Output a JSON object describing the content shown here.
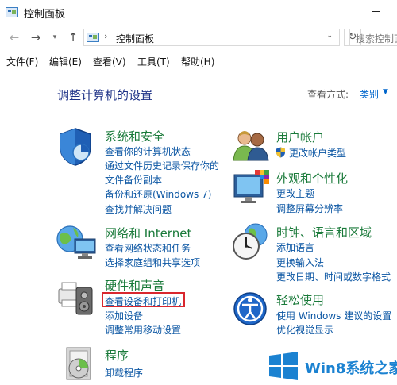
{
  "window": {
    "title": "控制面板"
  },
  "address": {
    "path": "控制面板",
    "separator": "›",
    "search_placeholder": "搜索控制面"
  },
  "menu": [
    "文件(F)",
    "编辑(E)",
    "查看(V)",
    "工具(T)",
    "帮助(H)"
  ],
  "main": {
    "heading": "调整计算机的设置",
    "view_by_label": "查看方式:",
    "view_by_value": "类别"
  },
  "categories": {
    "system": {
      "title": "系统和安全",
      "links": [
        "查看你的计算机状态",
        "通过文件历史记录保存你的",
        "文件备份副本",
        "备份和还原(Windows 7)",
        "查找并解决问题"
      ]
    },
    "network": {
      "title": "网络和 Internet",
      "links": [
        "查看网络状态和任务",
        "选择家庭组和共享选项"
      ]
    },
    "hardware": {
      "title": "硬件和声音",
      "links": [
        "查看设备和打印机",
        "添加设备",
        "调整常用移动设置"
      ]
    },
    "programs": {
      "title": "程序",
      "links": [
        "卸载程序"
      ]
    },
    "users": {
      "title": "用户帐户",
      "links": [
        "更改帐户类型"
      ]
    },
    "appearance": {
      "title": "外观和个性化",
      "links": [
        "更改主题",
        "调整屏幕分辨率"
      ]
    },
    "clock": {
      "title": "时钟、语言和区域",
      "links": [
        "添加语言",
        "更换输入法",
        "更改日期、时间或数字格式"
      ]
    },
    "ease": {
      "title": "轻松使用",
      "links": [
        "使用 Windows 建议的设置",
        "优化视觉显示"
      ]
    }
  },
  "watermark": {
    "text": "Win8系统之家"
  },
  "colors": {
    "category_title": "#1a7a3a",
    "link": "#0b56a3",
    "heading": "#1e3287",
    "highlight": "#d9272e",
    "watermark": "#1b82d1"
  }
}
